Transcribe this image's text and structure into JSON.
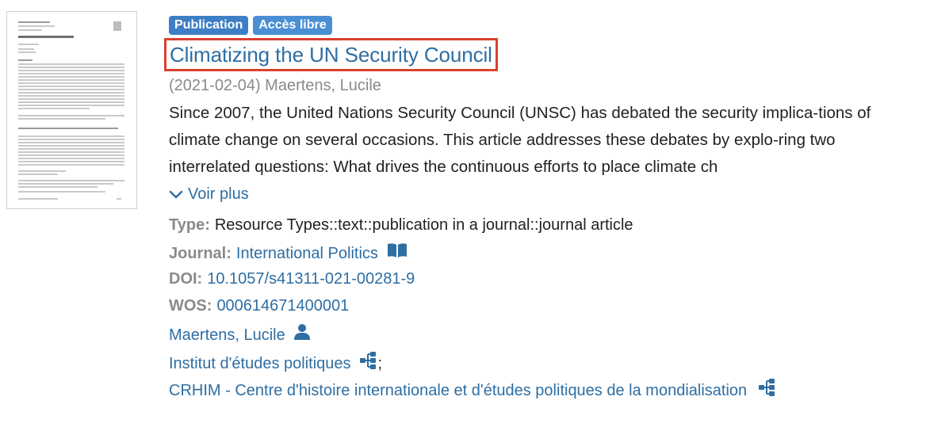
{
  "result": {
    "badges": {
      "type_label": "Publication",
      "access_label": "Accès libre"
    },
    "title": "Climatizing the UN Security Council",
    "date_author": "(2021-02-04) Maertens, Lucile",
    "abstract": "Since 2007, the United Nations Security Council (UNSC) has debated the security implica-tions of climate change on several occasions. This article addresses these debates by explo-ring two interrelated questions: What drives the continuous efforts to place climate ch",
    "voir_plus": "Voir plus",
    "type": {
      "label": "Type:",
      "value": "Resource Types::text::publication in a journal::journal article"
    },
    "journal": {
      "label": "Journal:",
      "value": "International Politics",
      "icon": "book-icon"
    },
    "doi": {
      "label": "DOI:",
      "value": "10.1057/s41311-021-00281-9"
    },
    "wos": {
      "label": "WOS:",
      "value": "000614671400001"
    },
    "author": {
      "value": "Maertens, Lucile",
      "icon": "person-icon"
    },
    "institute": {
      "value": "Institut d'études politiques",
      "suffix": ";",
      "icon": "sitemap-icon"
    },
    "center": {
      "value": "CRHIM - Centre d'histoire internationale et d'études politiques de la mondialisation",
      "icon": "sitemap-icon"
    }
  },
  "colors": {
    "link": "#2e6ea3",
    "badge": "#3d7fc4",
    "highlight": "#d9412f",
    "muted": "#8a8a8a"
  }
}
